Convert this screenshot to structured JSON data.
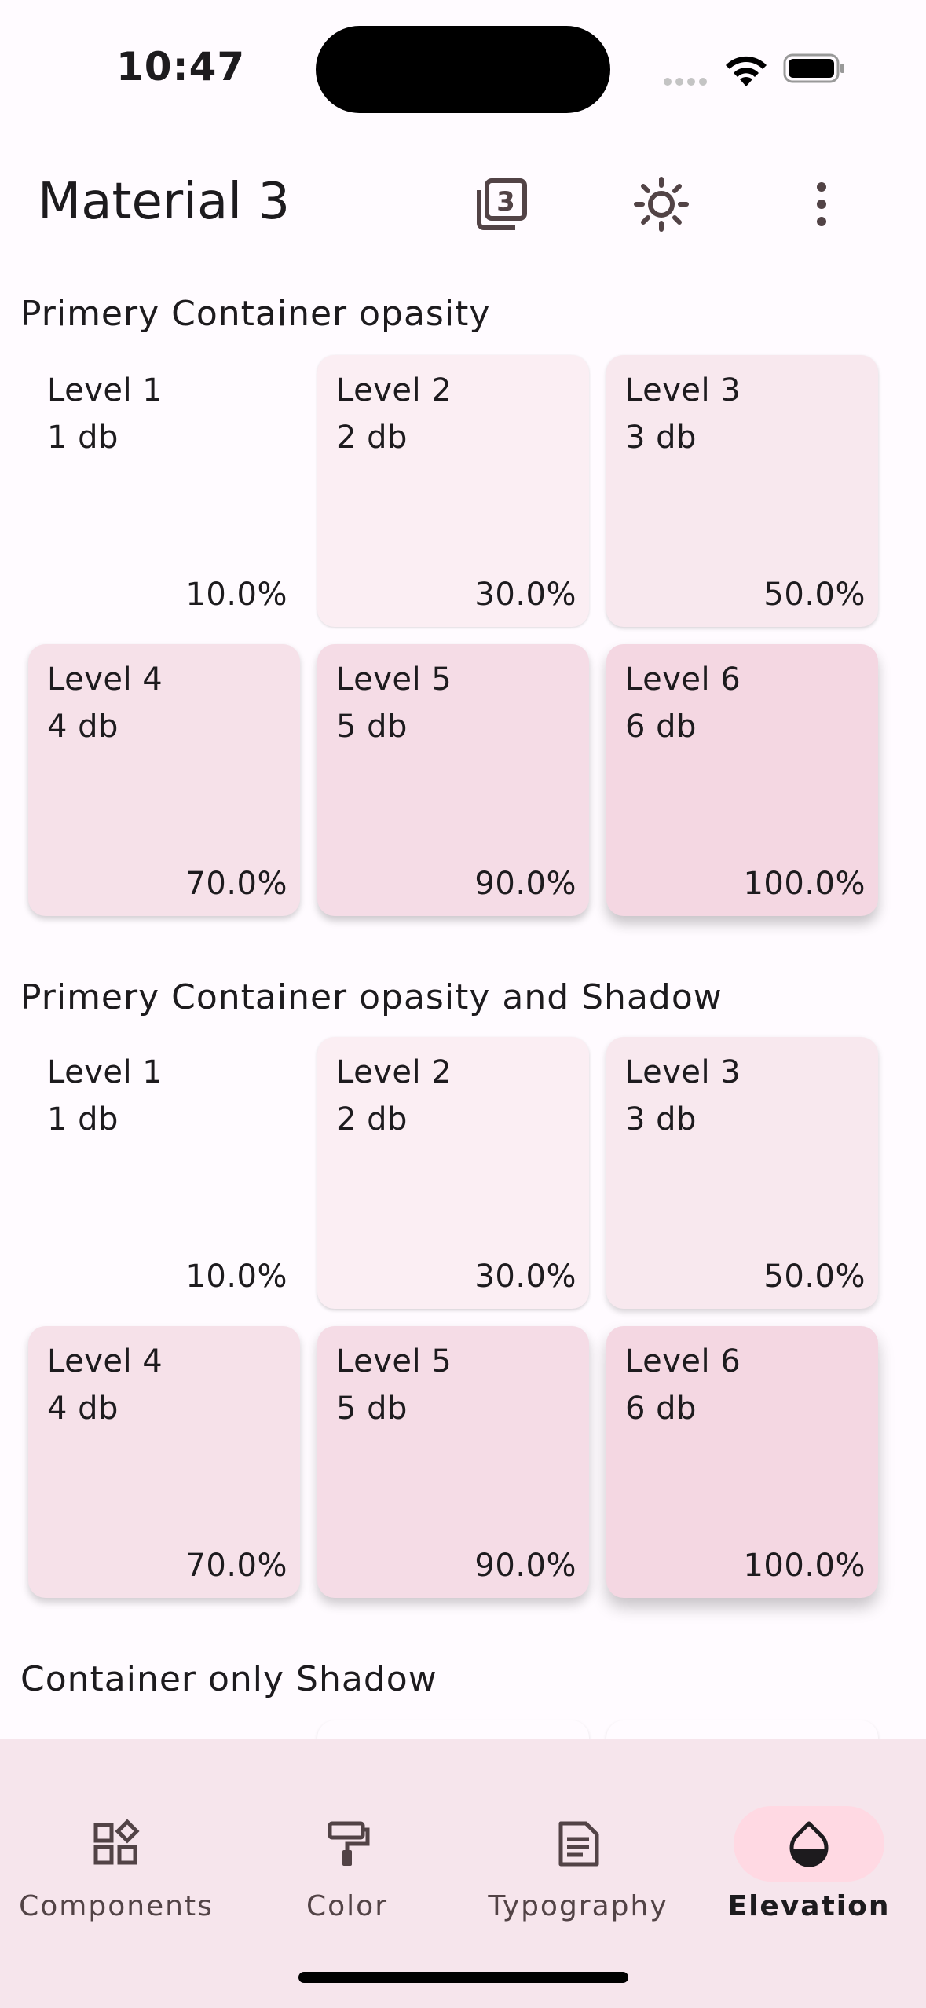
{
  "status": {
    "time": "10:47"
  },
  "appbar": {
    "title": "Material 3",
    "icons": [
      "material-3-badge-icon",
      "brightness-icon",
      "more-vert-icon"
    ]
  },
  "sections": [
    {
      "title": "Primery Container opasity",
      "cards": [
        {
          "level": "Level 1",
          "db": "1 db",
          "pct": "10.0%"
        },
        {
          "level": "Level 2",
          "db": "2 db",
          "pct": "30.0%"
        },
        {
          "level": "Level 3",
          "db": "3 db",
          "pct": "50.0%"
        },
        {
          "level": "Level 4",
          "db": "4 db",
          "pct": "70.0%"
        },
        {
          "level": "Level 5",
          "db": "5 db",
          "pct": "90.0%"
        },
        {
          "level": "Level 6",
          "db": "6 db",
          "pct": "100.0%"
        }
      ]
    },
    {
      "title": "Primery Container opasity and Shadow",
      "cards": [
        {
          "level": "Level 1",
          "db": "1 db",
          "pct": "10.0%"
        },
        {
          "level": "Level 2",
          "db": "2 db",
          "pct": "30.0%"
        },
        {
          "level": "Level 3",
          "db": "3 db",
          "pct": "50.0%"
        },
        {
          "level": "Level 4",
          "db": "4 db",
          "pct": "70.0%"
        },
        {
          "level": "Level 5",
          "db": "5 db",
          "pct": "90.0%"
        },
        {
          "level": "Level 6",
          "db": "6 db",
          "pct": "100.0%"
        }
      ]
    },
    {
      "title": "Container only Shadow"
    }
  ],
  "nav": [
    {
      "label": "Components",
      "icon": "widgets-icon",
      "active": false
    },
    {
      "label": "Color",
      "icon": "format-paint-icon",
      "active": false
    },
    {
      "label": "Typography",
      "icon": "article-icon",
      "active": false
    },
    {
      "label": "Elevation",
      "icon": "opacity-drop-icon",
      "active": true
    }
  ],
  "colors": {
    "background": "#fffbff",
    "card_tints": [
      "#fffbff",
      "#fbeef3",
      "#f8e8ee",
      "#f6e1e9",
      "#f5dce6",
      "#f4d7e2"
    ],
    "nav_background": "#f6e5ec",
    "active_indicator": "#ffd9e3"
  }
}
